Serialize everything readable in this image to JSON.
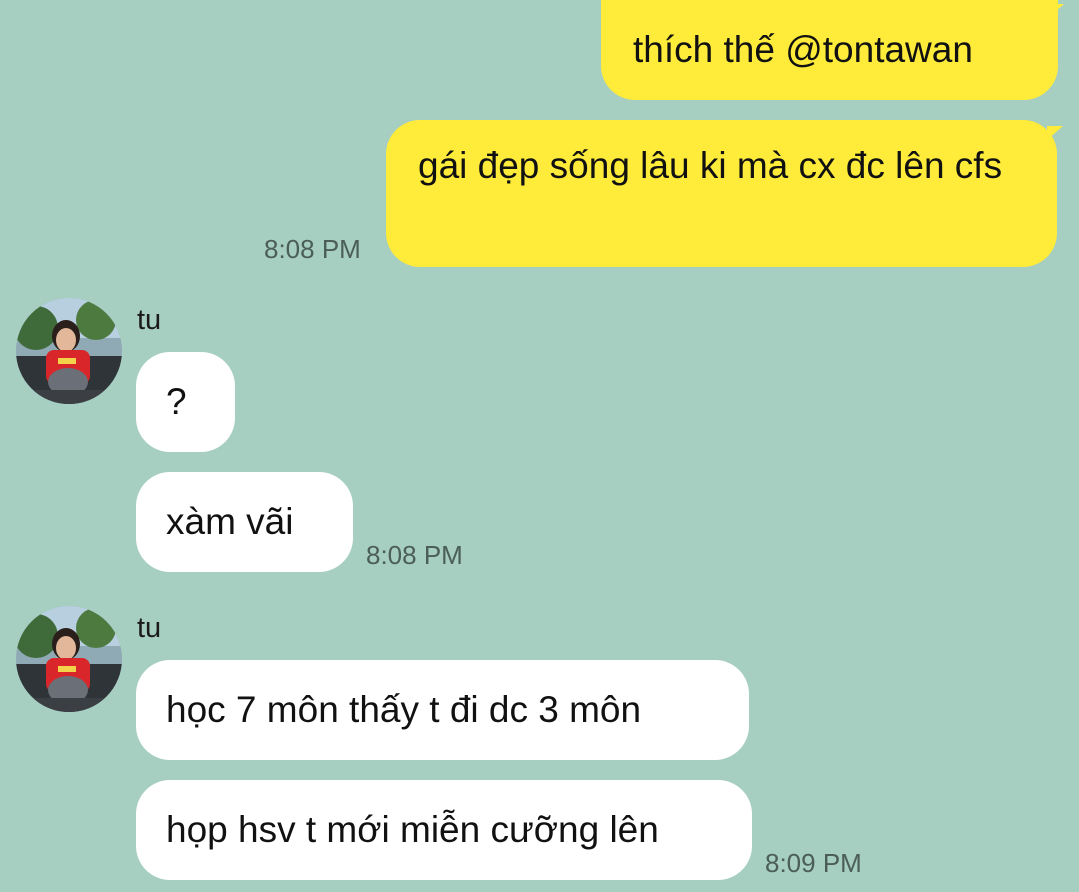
{
  "messages": {
    "out_1": {
      "text": "thích thế @tontawan"
    },
    "out_2": {
      "text": "gái đẹp sống lâu ki mà cx đc lên cfs",
      "time": "8:08 PM"
    },
    "group_1": {
      "sender": "tu",
      "msg_1": "?",
      "msg_2": "xàm vãi",
      "time": "8:08 PM"
    },
    "group_2": {
      "sender": "tu",
      "msg_1": "học 7 môn thấy t đi dc 3 môn",
      "msg_2": "họp hsv t mới miễn cưỡng lên",
      "time": "8:09 PM"
    }
  },
  "colors": {
    "background": "#a6cec1",
    "outgoing_bubble": "#feeb3a",
    "incoming_bubble": "#ffffff",
    "timestamp": "#4b5e57"
  },
  "icons": {
    "avatar": "profile-photo-avatar"
  }
}
